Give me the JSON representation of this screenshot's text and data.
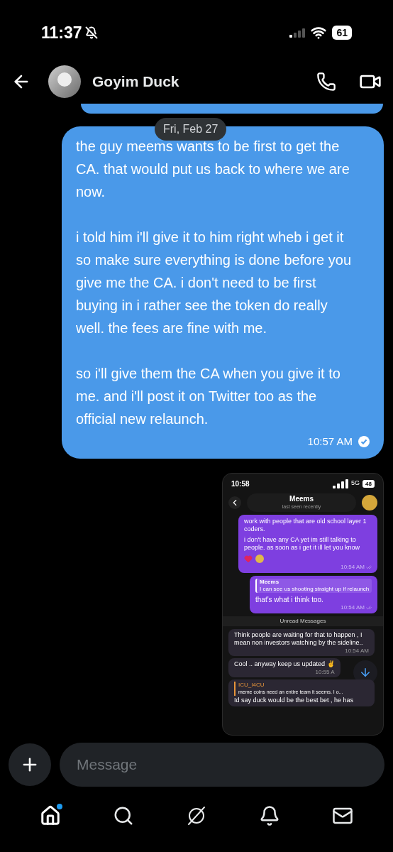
{
  "status_bar": {
    "time": "11:37",
    "battery": "61"
  },
  "header": {
    "name": "Goyim Duck"
  },
  "date_separator": "Fri, Feb 27",
  "message": {
    "paragraphs": [
      "the guy meems wants to be first to get the CA.  that would put us back to where we are now.",
      "i told him i'll give it to him right wheb i get it so make sure everything is done before you give me the CA.  i don't need to be first buying in i rather see the token do really well.  the fees are fine with me.",
      "so i'll give them the CA when you give it to me.  and i'll post it on Twitter too as the official new relaunch."
    ],
    "time": "10:57 AM",
    "read": true
  },
  "attachment": {
    "status_time": "10:58",
    "network": "5G",
    "battery": "48",
    "contact": "Meems",
    "last_seen": "last seen recently",
    "outgoing": [
      {
        "kind": "plain",
        "paragraphs": [
          "work with people that are old school layer 1 coders.",
          "i don't have any CA yet im still talking to people.  as soon as i get it ill let you know"
        ],
        "reactions": true,
        "time": "10:54 AM"
      },
      {
        "kind": "reply",
        "reply_name": "Meems",
        "reply_text": "I can see us shooting straight up if relaunch",
        "text": "that's what i think too.",
        "time": "10:54 AM"
      }
    ],
    "divider": "Unread Messages",
    "incoming": [
      {
        "kind": "plain",
        "text": "Think people are waiting for that to happen , I mean non investors watching by the sideline..",
        "time": "10:54 AM"
      },
      {
        "kind": "plain",
        "text": "Cool .. anyway keep us updated ✌️",
        "time": "10:55 A"
      },
      {
        "kind": "reply",
        "reply_name": "ICU_I4CU",
        "reply_text": "meme coins need an entire team it seems. I o...",
        "text": "Id say duck would be the best bet , he has"
      }
    ]
  },
  "composer": {
    "placeholder": "Message"
  },
  "nav": [
    {
      "kind": "home",
      "selected": true,
      "badge": true
    },
    {
      "kind": "search",
      "selected": false,
      "badge": false
    },
    {
      "kind": "grok",
      "selected": false,
      "badge": false
    },
    {
      "kind": "bell",
      "selected": false,
      "badge": false
    },
    {
      "kind": "mail",
      "selected": false,
      "badge": false
    }
  ]
}
